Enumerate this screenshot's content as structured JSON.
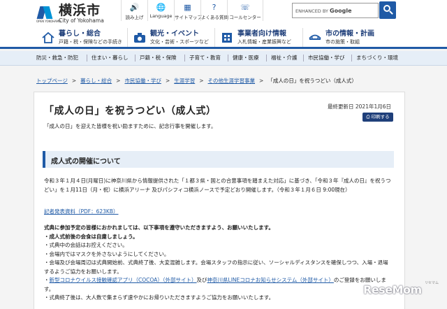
{
  "header": {
    "logo_mark_text": "OPEN YOKOHAMA",
    "logo_jp": "横浜市",
    "logo_en": "City of Yokohama",
    "tools": [
      {
        "icon": "speaker-icon",
        "glyph": "🔊",
        "label": "読み上げ"
      },
      {
        "icon": "globe-icon",
        "glyph": "🌐",
        "label": "Language"
      },
      {
        "icon": "sitemap-icon",
        "glyph": "▦",
        "label": "サイトマップ"
      },
      {
        "icon": "question-icon",
        "glyph": "?",
        "label": "よくある質問"
      },
      {
        "icon": "phone-icon",
        "glyph": "☏",
        "label": "コールセンター"
      }
    ],
    "search_prefix": "ENHANCED BY",
    "search_brand": "Google"
  },
  "mainnav": [
    {
      "title": "暮らし・総合",
      "sub": "戸籍・税・保険などの手続き",
      "icon": "house-icon"
    },
    {
      "title": "観光・イベント",
      "sub": "文化・芸術・スポーツなど",
      "icon": "camera-icon"
    },
    {
      "title": "事業者向け情報",
      "sub": "入札情報・産業振興など",
      "icon": "building-icon"
    },
    {
      "title": "市の情報・計画",
      "sub": "市の施策・取組",
      "icon": "bridge-icon"
    }
  ],
  "categories": [
    "防災・救急・防犯",
    "住まい・暮らし",
    "戸籍・税・保険",
    "子育て・教育",
    "健康・医療",
    "福祉・介護",
    "市民協働・学び",
    "まちづくり・環境"
  ],
  "breadcrumb": [
    "トップページ",
    "暮らし・総合",
    "市民協働・学び",
    "生涯学習",
    "その他生涯学習事業",
    "「成人の日」を祝うつどい（成人式）"
  ],
  "page": {
    "title": "「成人の日」を祝うつどい（成人式）",
    "updated": "最終更新日 2021年1月6日",
    "print_label": "印刷する",
    "lead": "「成人の日」を迎えた皆様を祝い励ますために、記念行事を開催します。",
    "section_heading": "成人式の開催について",
    "p1": "令和３年１月４日(月曜日)に神奈川県から情報提供された「１都３県・国との合意事項を踏まえた対応」に基づき、「令和３年『成人の日』を祝うつどい」を１月11日（月・祝）に横浜アリーナ 及びパシフィコ横浜ノースで予定どおり開催します。（令和３年１月６日 9:00現在）",
    "p2_link": "記者発表資料（PDF：623KB）",
    "p3_bold": "式典に参加予定の皆様におかれましては、以下事項を遵守いただきますよう、お願いいたします。",
    "p3_bold2": "・成人式前後の会食は自粛しましょう。",
    "p3_l1": "・式典中の会話はお控えください。",
    "p3_l2": "・会場内ではマスクを外さないようにしてください。",
    "p3_l3": "・会場及び会場周辺は式典開始前、式典終了後、大変混雑します。会場スタッフの指示に従い、ソーシャルディスタンスを確保しつつ、入場・退場するようご協力をお願いします。",
    "p3_l4_pre": "・",
    "p3_l4_link1": "新型コロナウイルス接触確認アプリ（COCOA）（外部サイト）",
    "p3_l4_mid": "及び",
    "p3_l4_link2": "神奈川県LINEコロナお知らせシステム（外部サイト）",
    "p3_l4_post": "のご登録をお願いします。",
    "p3_l5": "・式典終了後は、大人数で集まらず速やかにお帰りいただきますようご協力をお願いいたします。"
  },
  "watermark": {
    "text": "ReseMom",
    "small": "リセマム"
  }
}
